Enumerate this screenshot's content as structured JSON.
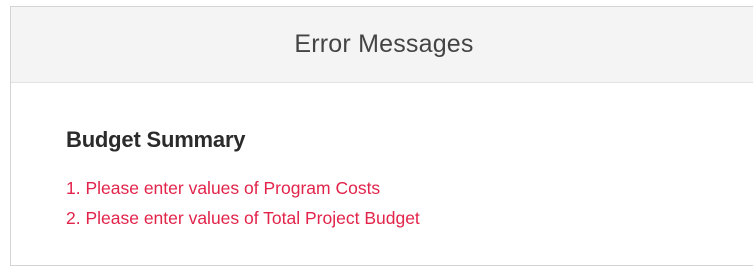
{
  "dialog": {
    "title": "Error Messages"
  },
  "section": {
    "title": "Budget Summary",
    "errors": [
      "1. Please enter values of Program Costs",
      "2. Please enter values of Total Project Budget"
    ]
  },
  "colors": {
    "error_text": "#e2234a",
    "header_bg": "#f4f4f4",
    "title_text": "#444444"
  }
}
